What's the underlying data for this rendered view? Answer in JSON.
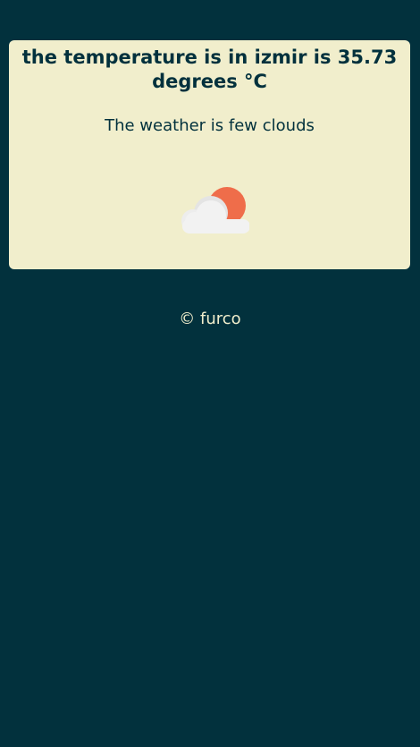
{
  "weather": {
    "headline": "the temperature is in izmir is 35.73 degrees °C",
    "description": "The weather is few clouds",
    "icon": "few-clouds-icon"
  },
  "footer": {
    "text": "© furco"
  },
  "colors": {
    "background": "#02313d",
    "card": "#f1eecc",
    "sun": "#ef6d4a",
    "cloud": "#f2f2f2"
  }
}
